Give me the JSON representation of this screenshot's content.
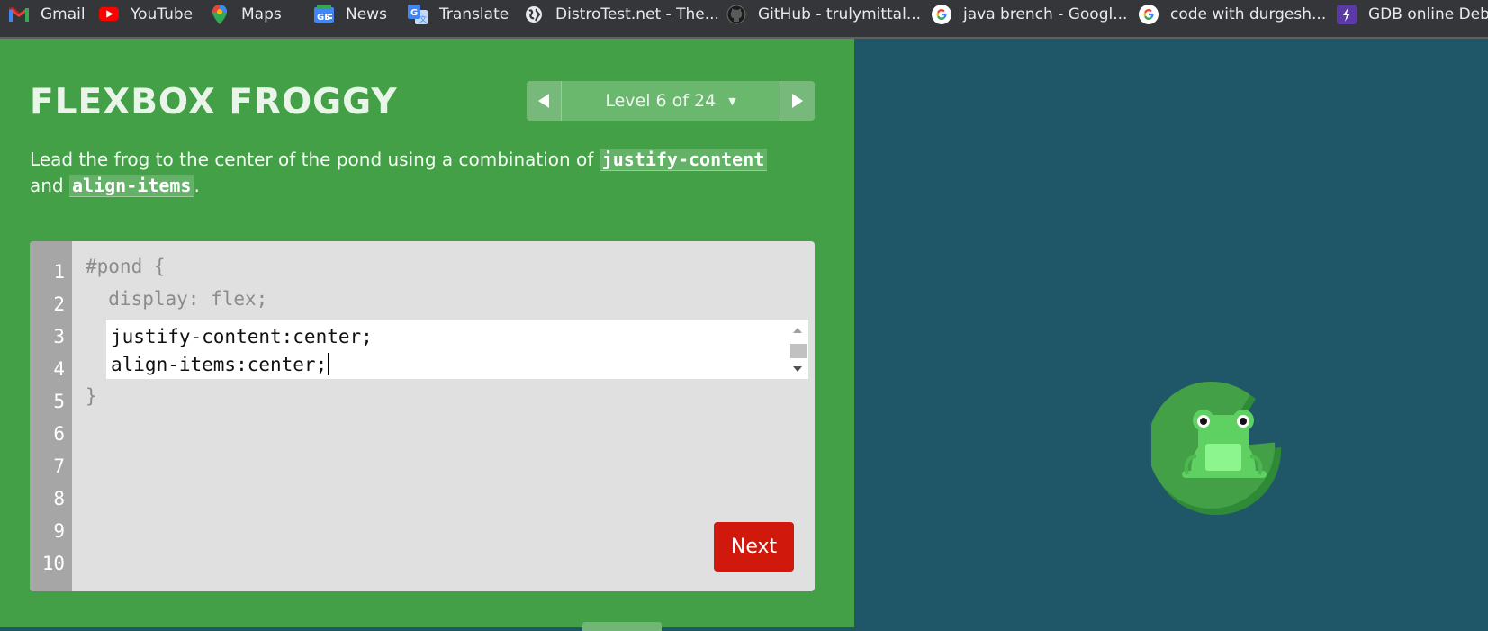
{
  "bookmarks": [
    {
      "label": "Gmail",
      "icon": "gmail-icon"
    },
    {
      "label": "YouTube",
      "icon": "youtube-icon"
    },
    {
      "label": "Maps",
      "icon": "maps-icon"
    },
    {
      "label": "News",
      "icon": "news-icon"
    },
    {
      "label": "Translate",
      "icon": "translate-icon"
    },
    {
      "label": "DistroTest.net - The...",
      "icon": "globe-icon"
    },
    {
      "label": "GitHub - trulymittal...",
      "icon": "github-icon"
    },
    {
      "label": "java brench - Googl...",
      "icon": "google-icon"
    },
    {
      "label": "code with durgesh...",
      "icon": "google-icon"
    },
    {
      "label": "GDB online Debu",
      "icon": "gdb-icon"
    }
  ],
  "game": {
    "title": "Flexbox Froggy",
    "level_label": "Level 6 of 24",
    "instructions_before": "Lead the frog to the center of the pond using a combination of ",
    "code_justify": "justify-content",
    "instructions_and": "and ",
    "code_align": "align-items",
    "instructions_end": "."
  },
  "editor": {
    "line_numbers": [
      "1",
      "2",
      "3",
      "4",
      "5",
      "6",
      "7",
      "8",
      "9",
      "10"
    ],
    "line1": "#pond {",
    "line2": "  display: flex;",
    "input_line1": "justify-content:center;",
    "input_line2": "align-items:center;",
    "line5": "}"
  },
  "next_label": "Next",
  "colors": {
    "game_green": "#43a047",
    "pond_blue": "#1f5768",
    "next_red": "#d0190c",
    "lilypad": "#2e8b3a",
    "frog": "#5fd062"
  }
}
